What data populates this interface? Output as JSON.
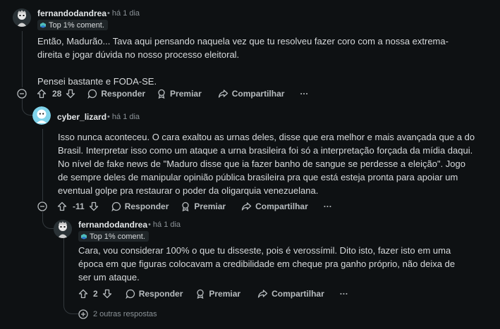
{
  "comments": [
    {
      "username": "fernandodandrea",
      "time": "• há 1 dia",
      "badge": "Top 1% coment.",
      "paragraphs": [
        "Então, Madurão... Tava aqui pensando naquela vez que tu resolveu fazer coro com a nossa extrema-direita e jogar dúvida no nosso processo eleitoral.",
        "Pensei bastante e FODA-SE."
      ],
      "score": "28",
      "actions": {
        "reply": "Responder",
        "award": "Premiar",
        "share": "Compartilhar",
        "more": "···"
      }
    },
    {
      "username": "cyber_lizard",
      "time": "• há 1 dia",
      "paragraphs": [
        "Isso nunca aconteceu. O cara exaltou as urnas deles, disse que era melhor e mais avançada que a do Brasil. Interpretar isso como um ataque a urna brasileira foi só a interpretação forçada da mídia daqui. No nível de fake news de \"Maduro disse que ia fazer banho de sangue se perdesse a eleição\". Jogo de sempre deles de manipular opinião pública brasileira pra que está esteja pronta para apoiar um eventual golpe pra restaurar o poder da oligarquia venezuelana."
      ],
      "score": "-11",
      "actions": {
        "reply": "Responder",
        "award": "Premiar",
        "share": "Compartilhar",
        "more": "···"
      }
    },
    {
      "username": "fernandodandrea",
      "time": "• há 1 dia",
      "badge": "Top 1% coment.",
      "paragraphs": [
        "Cara, vou considerar 100% o que tu disseste, pois é verossímil. Dito isto, fazer isto em uma época em que figuras colocavam a credibilidade em cheque pra ganho próprio, não deixa de ser um ataque."
      ],
      "score": "2",
      "actions": {
        "reply": "Responder",
        "award": "Premiar",
        "share": "Compartilhar",
        "more": "···"
      }
    }
  ],
  "more_replies": "2 outras respostas",
  "colors": {
    "background": "#0e1113",
    "text": "#d7dadc",
    "muted": "#8b9297",
    "thread_line": "#33393d",
    "badge_bg": "#1f2528"
  }
}
